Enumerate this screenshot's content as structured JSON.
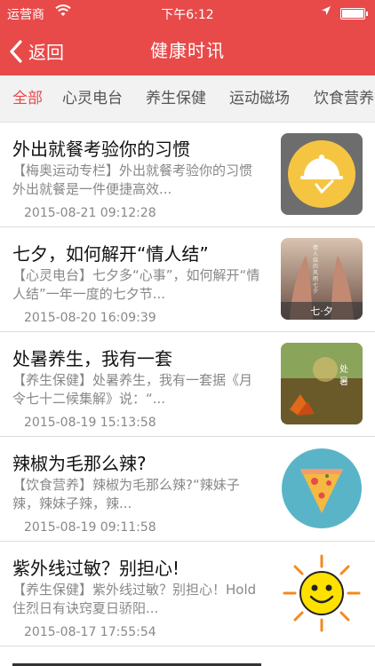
{
  "status_bar": {
    "carrier": "运营商",
    "time": "下午6:12",
    "battery_level": 1.0
  },
  "navbar": {
    "back_label": "返回",
    "title": "健康时讯"
  },
  "tabs": [
    {
      "label": "全部",
      "active": true
    },
    {
      "label": "心灵电台",
      "active": false
    },
    {
      "label": "养生保健",
      "active": false
    },
    {
      "label": "运动磁场",
      "active": false
    },
    {
      "label": "饮食营养",
      "active": false
    }
  ],
  "articles": [
    {
      "title": "外出就餐考验你的习惯",
      "summary": "【梅奥运动专栏】外出就餐考验你的习惯外出就餐是一件便捷高效...",
      "date": "2015-08-21 09:12:28",
      "thumb": "dining-cloche-icon"
    },
    {
      "title": "七夕，如何解开“情人结”",
      "summary": "【心灵电台】七夕多“心事”，如何解开“情人结”一年一度的七夕节...",
      "date": "2015-08-20 16:09:39",
      "thumb": "qixi-photo",
      "thumb_text": "七·夕",
      "thumb_vertical": "情人结的风雨七夕"
    },
    {
      "title": "处暑养生，我有一套",
      "summary": "【养生保健】处暑养生，我有一套据《月令七十二候集解》说：“...",
      "date": "2015-08-19 15:13:58",
      "thumb": "autumn-leaves-photo",
      "thumb_text": "处暑"
    },
    {
      "title": "辣椒为毛那么辣?",
      "summary": "【饮食营养】辣椒为毛那么辣?“辣妹子辣，辣妹子辣，辣...",
      "date": "2015-08-19 09:11:58",
      "thumb": "pizza-slice-icon"
    },
    {
      "title": "紫外线过敏？别担心!",
      "summary": "【养生保健】紫外线过敏？别担心！Hold住烈日有诀窍夏日骄阳...",
      "date": "2015-08-17 17:55:54",
      "thumb": "smiling-sun-icon"
    }
  ]
}
